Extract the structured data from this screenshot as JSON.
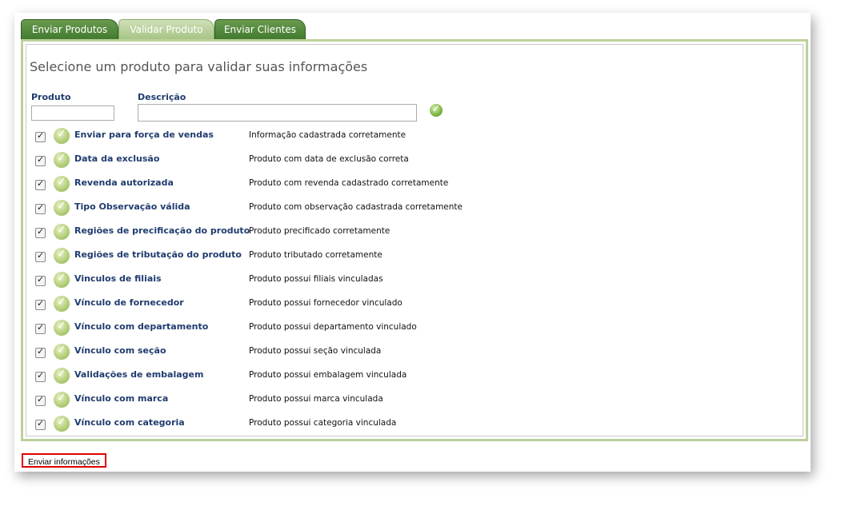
{
  "tabs": [
    "Enviar Produtos",
    "Validar Produto",
    "Enviar Clientes"
  ],
  "active_tab": "Validar Produto",
  "heading": "Selecione um produto para validar suas informações",
  "fields": {
    "produto_label": "Produto",
    "produto_value": "",
    "descricao_label": "Descrição",
    "descricao_value": ""
  },
  "checks": [
    {
      "label": "Enviar para força de vendas",
      "desc": "Informação cadastrada corretamente",
      "checked": true
    },
    {
      "label": "Data da exclusão",
      "desc": "Produto com data de exclusão correta",
      "checked": true
    },
    {
      "label": "Revenda autorizada",
      "desc": "Produto com revenda cadastrado corretamente",
      "checked": true
    },
    {
      "label": "Tipo Observação válida",
      "desc": "Produto com observação cadastrada corretamente",
      "checked": true
    },
    {
      "label": "Regiões de precificação do produto",
      "desc": "Produto precificado corretamente",
      "checked": true
    },
    {
      "label": "Regiões de tributação do produto",
      "desc": "Produto tributado corretamente",
      "checked": true
    },
    {
      "label": "Vinculos de filiais",
      "desc": "Produto possui filiais vinculadas",
      "checked": true
    },
    {
      "label": "Vínculo de fornecedor",
      "desc": "Produto possui fornecedor vinculado",
      "checked": true
    },
    {
      "label": "Vínculo com departamento",
      "desc": "Produto possui departamento vinculado",
      "checked": true
    },
    {
      "label": "Vínculo com seção",
      "desc": "Produto possui seção vinculada",
      "checked": true
    },
    {
      "label": "Validações de embalagem",
      "desc": "Produto possui embalagem vinculada",
      "checked": true
    },
    {
      "label": "Vínculo com marca",
      "desc": "Produto possui marca vinculada",
      "checked": true
    },
    {
      "label": "Vínculo com categoria",
      "desc": "Produto possui categoria vinculada",
      "checked": true
    }
  ],
  "send_button": "Enviar informações",
  "colors": {
    "tab_green": "#3f7a2e",
    "panel_border": "#bcd19b",
    "label_blue": "#1f3c6e",
    "highlight_red": "#e00000"
  }
}
